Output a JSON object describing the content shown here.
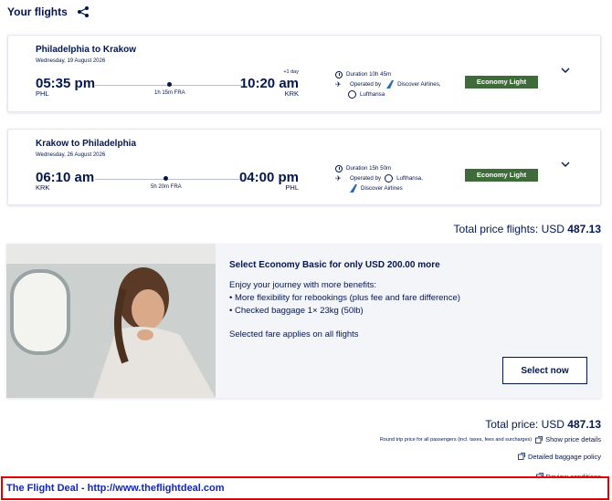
{
  "header": {
    "title": "Your flights"
  },
  "flights": [
    {
      "route": "Philadelphia to Krakow",
      "date": "Wednesday, 19 August 2026",
      "dep_time": "05:35 pm",
      "dep_code": "PHL",
      "arr_time": "10:20 am",
      "arr_code": "KRK",
      "plus_day": "+1 day",
      "stop": "1h 15m FRA",
      "duration": "Duration 10h 45m",
      "operated_label": "Operated by",
      "carrier_1": "Discover Airlines,",
      "carrier_2": "Lufthansa",
      "fare": "Economy Light"
    },
    {
      "route": "Krakow to Philadelphia",
      "date": "Wednesday, 26 August 2026",
      "dep_time": "06:10 am",
      "dep_code": "KRK",
      "arr_time": "04:00 pm",
      "arr_code": "PHL",
      "stop": "5h 20m FRA",
      "duration": "Duration 15h 50m",
      "operated_label": "Operated by",
      "carrier_1": "Lufthansa,",
      "carrier_2": "Discover Airlines",
      "fare": "Economy Light"
    }
  ],
  "total_flights": {
    "label": "Total price flights:",
    "currency": "USD",
    "amount": "487.13"
  },
  "upsell": {
    "title": "Select Economy Basic for only USD 200.00 more",
    "intro": "Enjoy your journey with more benefits:",
    "benefit_1": "• More flexibility for rebookings (plus fee and fare difference)",
    "benefit_2": "• Checked baggage 1× 23kg (50lb)",
    "note": "Selected fare applies on all flights",
    "button": "Select now"
  },
  "total_price": {
    "label": "Total price:",
    "currency": "USD",
    "amount": "487.13",
    "note": "Round trip price for all passengers (incl. taxes, fees and surcharges)"
  },
  "links": {
    "price_details": "Show price details",
    "baggage": "Detailed baggage policy",
    "conditions": "Review conditions"
  },
  "footer": {
    "text": "The Flight Deal - http://www.theflightdeal.com"
  },
  "colors": {
    "navy": "#05164d",
    "fare_green": "#3f6a3a",
    "footer_border": "#e00000",
    "footer_text": "#1226b8"
  }
}
